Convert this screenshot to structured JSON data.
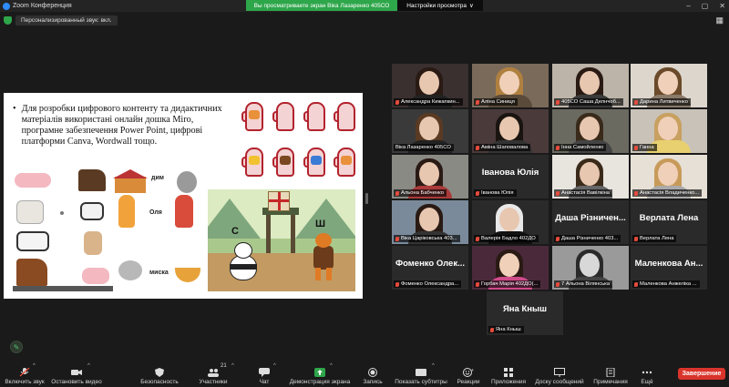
{
  "window": {
    "app_name": "Zoom Конференция",
    "share_banner": "Вы просматриваете экран Віка Лазаренко 405СО",
    "view_options": "Настройки просмотра",
    "view_options_caret": "∨"
  },
  "subbar": {
    "audio_label": "Персонализированный звук: вкл.",
    "view_label": "Вид"
  },
  "slide": {
    "bullet": "•",
    "text": "Для розробки цифрового контенту та дидактичних матеріалів використані онлайн дошка Miro, програмне забезпечення Power Point, цифрові платформи Canva, Wordwall тощо.",
    "words": [
      "дим",
      "Оля",
      "миска"
    ],
    "scene_letters": [
      "С",
      "Ш"
    ]
  },
  "participants": [
    {
      "name": "Александра Кижапкин...",
      "muted": true
    },
    {
      "name": "Аліна Синиця",
      "muted": true
    },
    {
      "name": "405СО Саша Делнчоб...",
      "muted": true
    },
    {
      "name": "Дарина Литвиченко",
      "muted": true
    },
    {
      "name": "Віка Лазаренко 405СО",
      "muted": false,
      "active": true
    },
    {
      "name": "Аміна Шаповалова",
      "muted": true
    },
    {
      "name": "Інна Самойленко",
      "muted": true
    },
    {
      "name": "Ганна",
      "muted": true
    },
    {
      "name": "Альона Бабченко",
      "muted": true
    },
    {
      "name": "Іванова Юлія",
      "big_name": "Іванова Юлія",
      "muted": true
    },
    {
      "name": "Анастасія Вавілкіна",
      "muted": true
    },
    {
      "name": "Анастасія Владиченко...",
      "muted": true
    },
    {
      "name": "Віка Царіковська 403...",
      "muted": true
    },
    {
      "name": "Валерія Бадло 402ДО",
      "muted": true
    },
    {
      "name": "Даша Різниченко 403...",
      "big_name": "Даша Різничен...",
      "muted": true
    },
    {
      "name": "Верлата Лена",
      "big_name": "Верлата Лена",
      "muted": true
    },
    {
      "name": "Фоменко Олександра...",
      "big_name": "Фоменко Олек...",
      "muted": true
    },
    {
      "name": "Горбач Марія 402ДО(...",
      "muted": true
    },
    {
      "name": "7 Альона Вілянська",
      "muted": true
    },
    {
      "name": "Маленкова Анжеліка ...",
      "big_name": "Маленкова Ан...",
      "muted": true
    },
    {
      "name": "Яна Кныш",
      "big_name": "Яна Кныш",
      "muted": true
    }
  ],
  "toolbar": {
    "mute": "Включить звук",
    "video": "Остановить видео",
    "security": "Безопасность",
    "participants": "Участники",
    "participants_count": "21",
    "chat": "Чат",
    "share": "Демонстрация экрана",
    "record": "Запись",
    "captions": "Показать субтитры",
    "captions_badge": "CC",
    "reactions": "Реакции",
    "apps": "Приложения",
    "whiteboards": "Доску сообщений",
    "notes": "Примечания",
    "more": "Ещё",
    "end": "Завершение"
  },
  "colors": {
    "share_banner": "#2ea64a",
    "end_button": "#d9342b",
    "active_speaker": "#c9e84d",
    "muted_mic": "#e74c3c"
  }
}
